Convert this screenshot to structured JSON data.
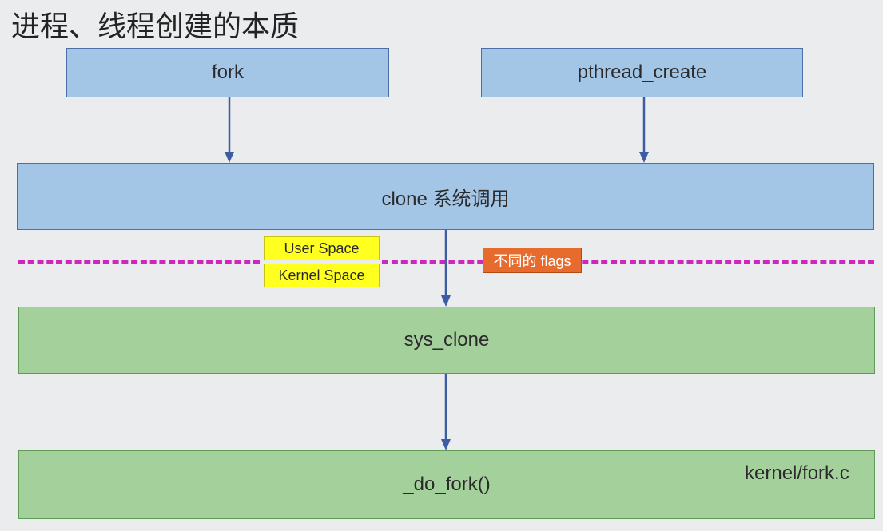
{
  "title": "进程、线程创建的本质",
  "boxes": {
    "fork": "fork",
    "pthread_create": "pthread_create",
    "clone": "clone 系统调用",
    "sys_clone": "sys_clone",
    "do_fork": "_do_fork()"
  },
  "badges": {
    "user_space": "User Space",
    "kernel_space": "Kernel Space",
    "flags": "不同的 flags"
  },
  "notes": {
    "file": "kernel/fork.c"
  },
  "colors": {
    "blue_fill": "#a3c5e6",
    "green_fill": "#a4d19b",
    "yellow_fill": "#ffff20",
    "orange_fill": "#e86b2e",
    "dash": "#d026c0",
    "arrow": "#3d5da3"
  }
}
